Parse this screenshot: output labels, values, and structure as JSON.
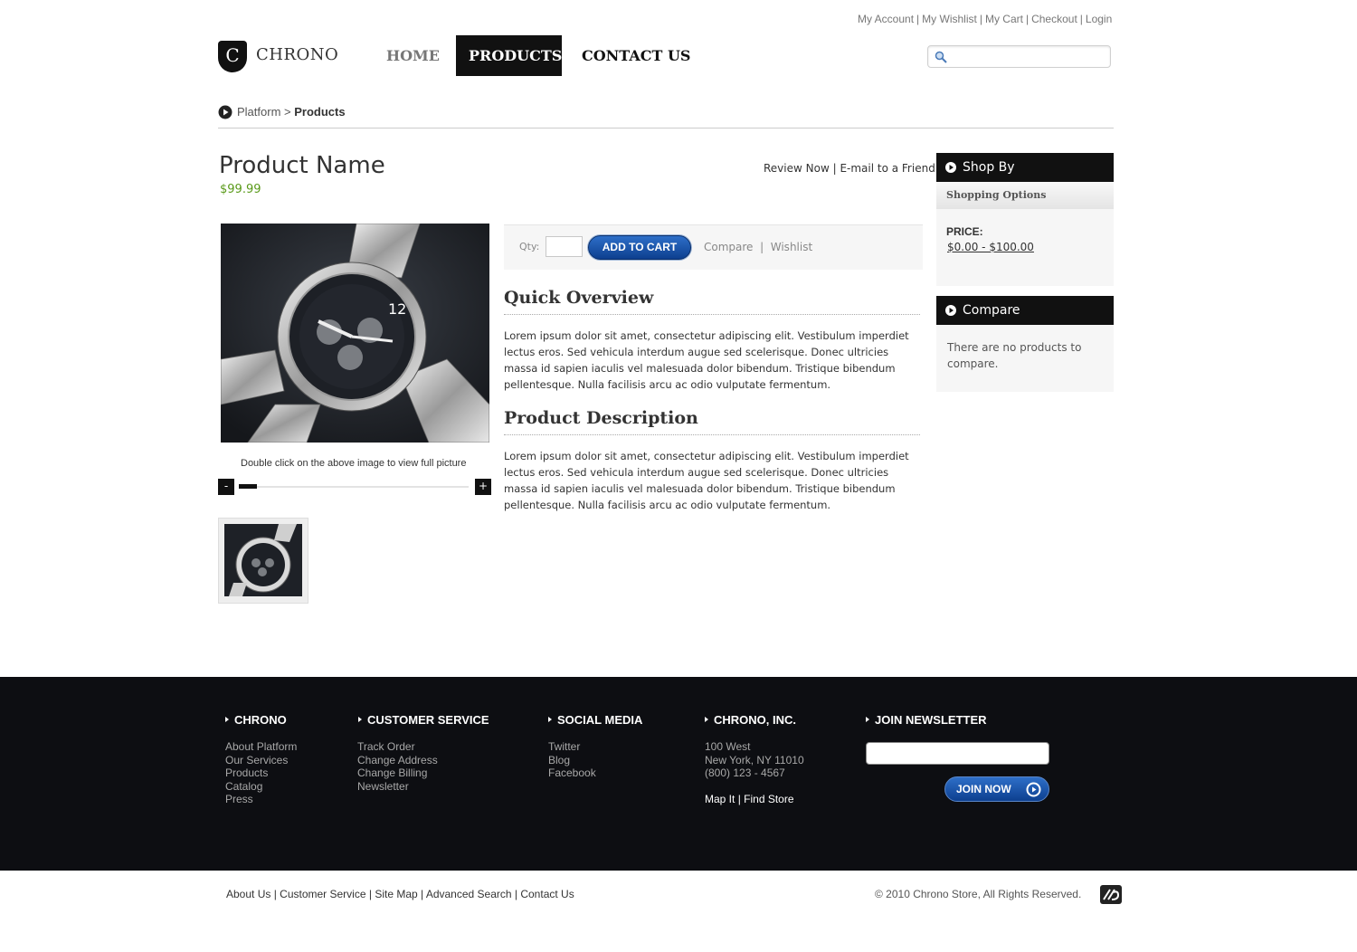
{
  "header": {
    "top_links": [
      "My Account",
      "My Wishlist",
      "My Cart",
      "Checkout",
      "Login"
    ],
    "logo_letter": "C",
    "logo_text": "CHRONO",
    "nav": {
      "home": "HOME",
      "products": "PRODUCTS",
      "contact": "CONTACT US"
    },
    "search": {
      "placeholder": "",
      "value": ""
    }
  },
  "breadcrumb": {
    "root": "Platform",
    "separator": ">",
    "current": "Products"
  },
  "product": {
    "name": "Product Name",
    "price": "$99.99",
    "review_link": "Review Now",
    "email_link": "E-mail to a Friend",
    "image_caption": "Double click on the above image to view full picture",
    "zoom_minus": "-",
    "zoom_plus": "+",
    "zoom_level": 0.08,
    "qty_label": "Qty:",
    "qty_value": "",
    "add_to_cart": "ADD TO CART",
    "compare_link": "Compare",
    "wishlist_link": "Wishlist",
    "overview_title": "Quick Overview",
    "overview_text": "Lorem ipsum dolor sit amet, consectetur adipiscing elit. Vestibulum imperdiet lectus eros. Sed vehicula interdum augue sed scelerisque. Donec ultricies massa id sapien iaculis vel malesuada dolor bibendum. Tristique bibendum pellentesque. Nulla facilisis arcu ac odio vulputate fermentum.",
    "description_title": "Product Description",
    "description_text": "Lorem ipsum dolor sit amet, consectetur adipiscing elit. Vestibulum imperdiet lectus eros. Sed vehicula interdum augue sed scelerisque. Donec ultricies massa id sapien iaculis vel malesuada dolor bibendum. Tristique bibendum pellentesque. Nulla facilisis arcu ac odio vulputate fermentum."
  },
  "sidebar": {
    "shop_by_title": "Shop By",
    "shopping_options": "Shopping Options",
    "price_label": "PRICE:",
    "price_range": "$0.00 - $100.00",
    "compare_title": "Compare",
    "compare_empty": "There are no products to compare."
  },
  "footer": {
    "columns": [
      {
        "title": "CHRONO",
        "items": [
          "About Platform",
          "Our Services",
          "Products",
          "Catalog",
          "Press"
        ]
      },
      {
        "title": "CUSTOMER SERVICE",
        "items": [
          "Track Order",
          "Change Address",
          "Change Billing",
          "Newsletter"
        ]
      },
      {
        "title": "SOCIAL MEDIA",
        "items": [
          "Twitter",
          "Blog",
          "Facebook"
        ]
      },
      {
        "title": "CHRONO, INC.",
        "items": [
          "100 West",
          "New York, NY 11010",
          "(800) 123 - 4567"
        ]
      },
      {
        "title": "JOIN NEWSLETTER",
        "items": []
      }
    ],
    "map_link": "Map It",
    "store_link": "Find Store",
    "newsletter_value": "",
    "join_button": "JOIN NOW"
  },
  "bottom": {
    "links": [
      "About Us",
      "Customer Service",
      "Site Map",
      "Advanced Search",
      "Contact Us"
    ],
    "copyright": "© 2010 Chrono Store, All Rights Reserved."
  },
  "colors": {
    "accent_dark": "#111111",
    "price_green": "#5a9a1a",
    "button_blue": "#0d3f8f",
    "footer_bg": "#0d0e12"
  },
  "icons": [
    "search-icon",
    "play-circle-icon",
    "arrow-right-circle-icon",
    "brand-logo-icon"
  ]
}
